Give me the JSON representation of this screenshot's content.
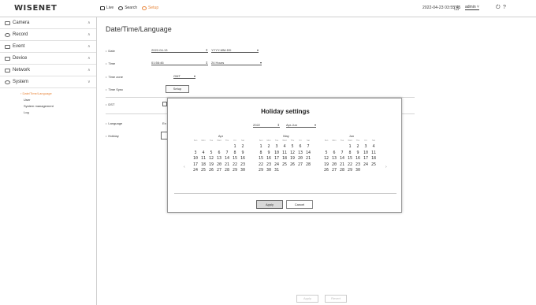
{
  "app": {
    "brand": "WISENET"
  },
  "topbar": {
    "nav": [
      {
        "label": "Live",
        "icon": "live-icon"
      },
      {
        "label": "Search",
        "icon": "search-icon"
      },
      {
        "label": "Setup",
        "icon": "setup-icon"
      }
    ],
    "datetime": "2022-04-23 03:55:45",
    "user": "admin",
    "help": "?"
  },
  "sidebar": {
    "items": [
      {
        "label": "Camera",
        "icon": "camera-icon"
      },
      {
        "label": "Record",
        "icon": "record-icon"
      },
      {
        "label": "Event",
        "icon": "event-icon"
      },
      {
        "label": "Device",
        "icon": "device-icon"
      },
      {
        "label": "Network",
        "icon": "network-icon"
      },
      {
        "label": "System",
        "icon": "system-icon"
      }
    ],
    "submenu": [
      "Date/Time/Language",
      "User",
      "System management",
      "Log"
    ]
  },
  "main": {
    "title": "Date/Time/Language",
    "date_label": "Date",
    "date_value": "2022-04-13",
    "date_format": "YYYY-MM-DD",
    "time_label": "Time",
    "time_value": "01:56:46",
    "time_format": "24 Hours",
    "timezone_label": "Time zone",
    "timezone_value": "GMT",
    "timesync_label": "Time Sync",
    "timesync_button": "Setup",
    "dst_label": "DST",
    "language_label": "Language",
    "language_value": "En",
    "holiday_label": "Holiday",
    "apply": "Apply",
    "revert": "Revert"
  },
  "modal": {
    "title": "Holiday settings",
    "year": "2022",
    "range": "Apr-Jun",
    "weekdays": [
      "Sun",
      "Mon",
      "Tue",
      "Wed",
      "Thu",
      "Fri",
      "Sat"
    ],
    "months": [
      {
        "name": "Apr",
        "weeks": [
          [
            "",
            "",
            "",
            "",
            "",
            "1",
            "2"
          ],
          [
            "3",
            "4",
            "5",
            "6",
            "7",
            "8",
            "9"
          ],
          [
            "10",
            "11",
            "12",
            "13",
            "14",
            "15",
            "16"
          ],
          [
            "17",
            "18",
            "19",
            "20",
            "21",
            "22",
            "23"
          ],
          [
            "24",
            "25",
            "26",
            "27",
            "28",
            "29",
            "30"
          ]
        ]
      },
      {
        "name": "May",
        "weeks": [
          [
            "1",
            "2",
            "3",
            "4",
            "5",
            "6",
            "7"
          ],
          [
            "8",
            "9",
            "10",
            "11",
            "12",
            "13",
            "14"
          ],
          [
            "15",
            "16",
            "17",
            "18",
            "19",
            "20",
            "21"
          ],
          [
            "22",
            "23",
            "24",
            "25",
            "26",
            "27",
            "28"
          ],
          [
            "29",
            "30",
            "31",
            "",
            "",
            "",
            ""
          ]
        ]
      },
      {
        "name": "Jun",
        "weeks": [
          [
            "",
            "",
            "",
            "1",
            "2",
            "3",
            "4"
          ],
          [
            "5",
            "6",
            "7",
            "8",
            "9",
            "10",
            "11"
          ],
          [
            "12",
            "13",
            "14",
            "15",
            "16",
            "17",
            "18"
          ],
          [
            "19",
            "20",
            "21",
            "22",
            "23",
            "24",
            "25"
          ],
          [
            "26",
            "27",
            "28",
            "29",
            "30",
            "",
            ""
          ]
        ]
      }
    ],
    "apply": "Apply",
    "cancel": "Cancel"
  }
}
